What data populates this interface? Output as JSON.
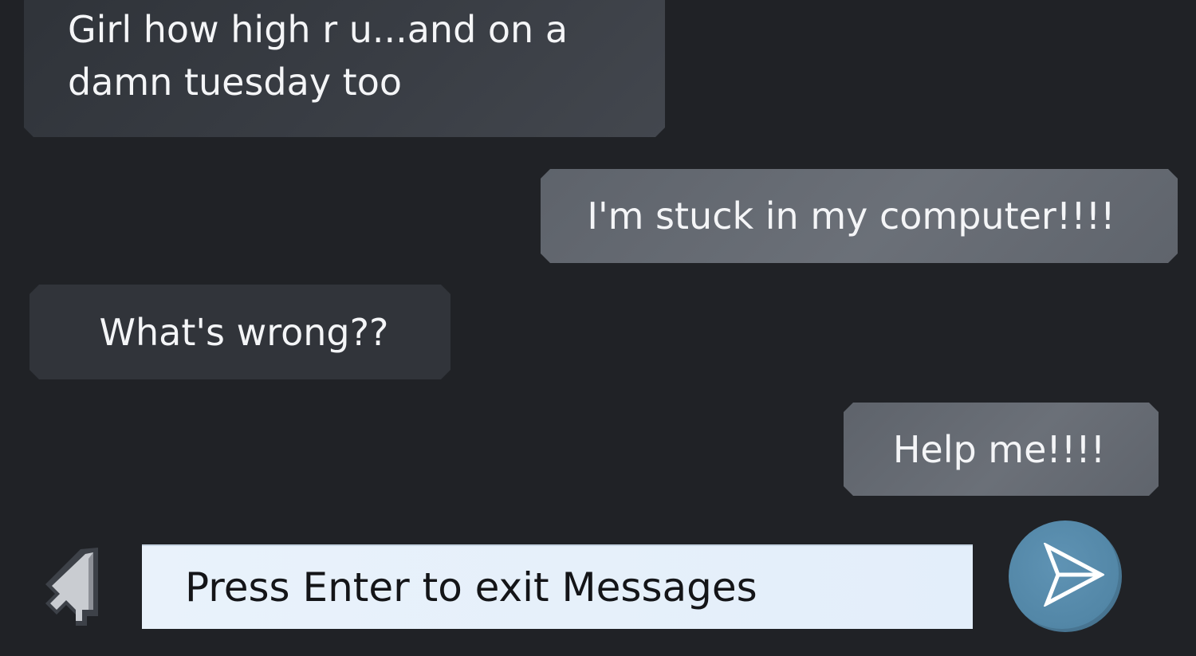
{
  "messages": [
    {
      "sender": "contact",
      "text": "Girl how high r u...and on a damn tuesday too"
    },
    {
      "sender": "me",
      "text": "I'm stuck in my computer!!!!"
    },
    {
      "sender": "contact",
      "text": "What's wrong??"
    },
    {
      "sender": "me",
      "text": "Help me!!!!"
    }
  ],
  "input": {
    "text": "Press Enter to exit Messages"
  },
  "icons": {
    "cursor": "pixel-arrow-cursor-icon",
    "send": "paper-plane-send-icon"
  },
  "colors": {
    "background": "#202226",
    "received_bubble": "#3a3e45",
    "sent_bubble": "#676c74",
    "input_background": "#e6f0fb",
    "send_button": "#5889aa"
  }
}
